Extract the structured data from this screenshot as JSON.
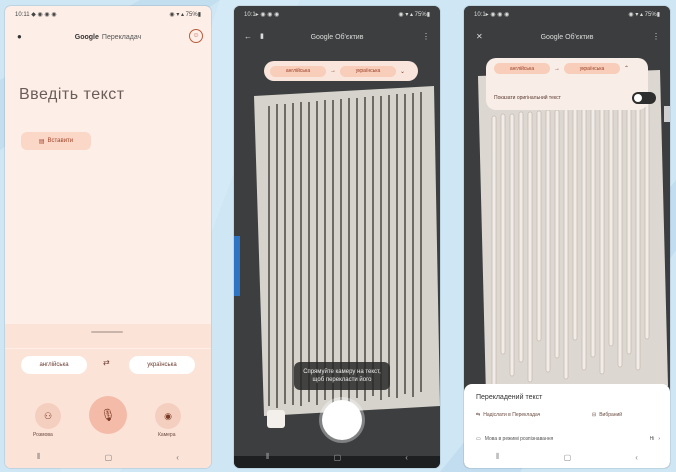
{
  "screen1": {
    "status_time": "10:11 ◆ ◉ ◉ ◉",
    "status_right": "◉ ▾ ▴ 75%▮",
    "app_title_brand": "Google",
    "app_title_rest": "Перекладач",
    "input_placeholder": "Введіть текст",
    "paste_label": "Вставити",
    "source_lang": "англійська",
    "target_lang": "українська",
    "swap_icon": "⇄",
    "conversation_label": "Розмова",
    "camera_label": "Камера"
  },
  "screen2": {
    "status_time": "10:1▸ ◉ ◉ ◉",
    "status_right": "◉ ▾ ▴ 75%▮",
    "app_title": "Google Об'єктив",
    "source_lang": "англійська",
    "target_lang": "українська",
    "arrow": "→",
    "toast_text": "Спрямуйте камеру на текст, щоб перекласти його"
  },
  "screen3": {
    "status_time": "10:1▸ ◉ ◉ ◉",
    "status_right": "◉ ▾ ▴ 75%▮",
    "app_title": "Google Об'єктив",
    "source_lang": "англійська",
    "target_lang": "українська",
    "arrow": "→",
    "show_original_label": "Показати оригінальний текст",
    "sheet_title": "Перекладений текст",
    "open_translator": "Надіслати в Перекладач",
    "selected": "Вибраний",
    "footer_text": "Мова в режимі розпізнавання",
    "footer_value": "Ні"
  },
  "colors": {
    "accent": "#a2442a",
    "pale_peach": "#fdeee8",
    "mic_button": "#f4bba8",
    "background": "#cfe6f4"
  }
}
